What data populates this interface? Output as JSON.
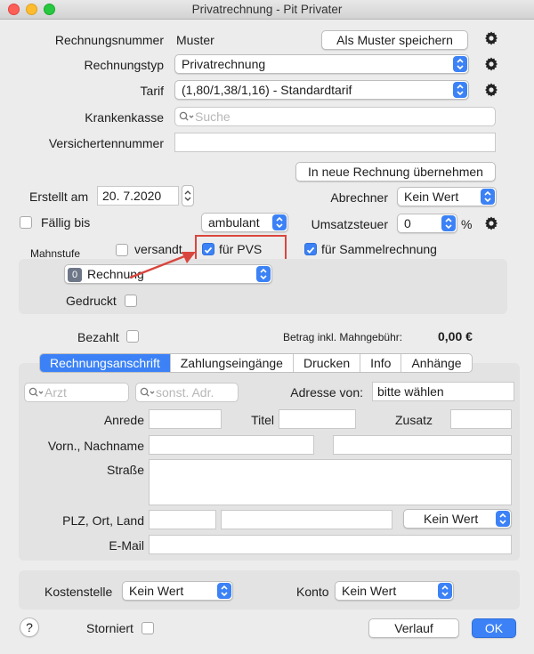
{
  "window": {
    "title": "Privatrechnung - Pit Privater"
  },
  "colors": {
    "accent": "#3c82f6",
    "highlight_box": "#d9463e"
  },
  "invoice": {
    "number_label": "Rechnungsnummer",
    "number_value": "Muster",
    "save_pattern_button": "Als Muster speichern",
    "type_label": "Rechnungstyp",
    "type_value": "Privatrechnung",
    "tariff_label": "Tarif",
    "tariff_value": "(1,80/1,38/1,16) - Standardtarif",
    "insurance_label": "Krankenkasse",
    "insurance_placeholder": "Suche",
    "insured_number_label": "Versichertennummer",
    "insured_number_value": "",
    "transfer_button": "In neue Rechnung übernehmen"
  },
  "details": {
    "created_label": "Erstellt am",
    "created_value": "20.  7.2020",
    "biller_label": "Abrechner",
    "biller_value": "Kein Wert",
    "due_label": "Fällig bis",
    "due_checked": false,
    "setting_value": "ambulant",
    "vat_label": "Umsatzsteuer",
    "vat_value": "0",
    "vat_unit": "%"
  },
  "dunning": {
    "label": "Mahnstufe",
    "sent_label": "versandt",
    "sent_checked": false,
    "pvs_label": "für PVS",
    "pvs_checked": true,
    "collective_label": "für Sammelrechnung",
    "collective_checked": true,
    "level_badge": "0",
    "level_value": "Rechnung",
    "printed_label": "Gedruckt",
    "printed_checked": false
  },
  "payment": {
    "paid_label": "Bezahlt",
    "paid_checked": false,
    "amount_label": "Betrag inkl. Mahngebühr:",
    "amount_value": "0,00 €"
  },
  "tabs": [
    {
      "label": "Rechnungsanschrift",
      "active": true
    },
    {
      "label": "Zahlungseingänge",
      "active": false
    },
    {
      "label": "Drucken",
      "active": false
    },
    {
      "label": "Info",
      "active": false
    },
    {
      "label": "Anhänge",
      "active": false
    }
  ],
  "address": {
    "doctor_placeholder": "Arzt",
    "other_placeholder": "sonst. Adr.",
    "address_from_label": "Adresse von:",
    "address_from_value": "bitte wählen",
    "salutation_label": "Anrede",
    "title_label": "Titel",
    "suffix_label": "Zusatz",
    "name_label": "Vorn., Nachname",
    "street_label": "Straße",
    "city_label": "PLZ, Ort, Land",
    "country_value": "Kein Wert",
    "email_label": "E-Mail"
  },
  "footer": {
    "cost_center_label": "Kostenstelle",
    "cost_center_value": "Kein Wert",
    "account_label": "Konto",
    "account_value": "Kein Wert",
    "help_label": "?",
    "cancelled_label": "Storniert",
    "cancelled_checked": false,
    "history_button": "Verlauf",
    "ok_button": "OK"
  }
}
